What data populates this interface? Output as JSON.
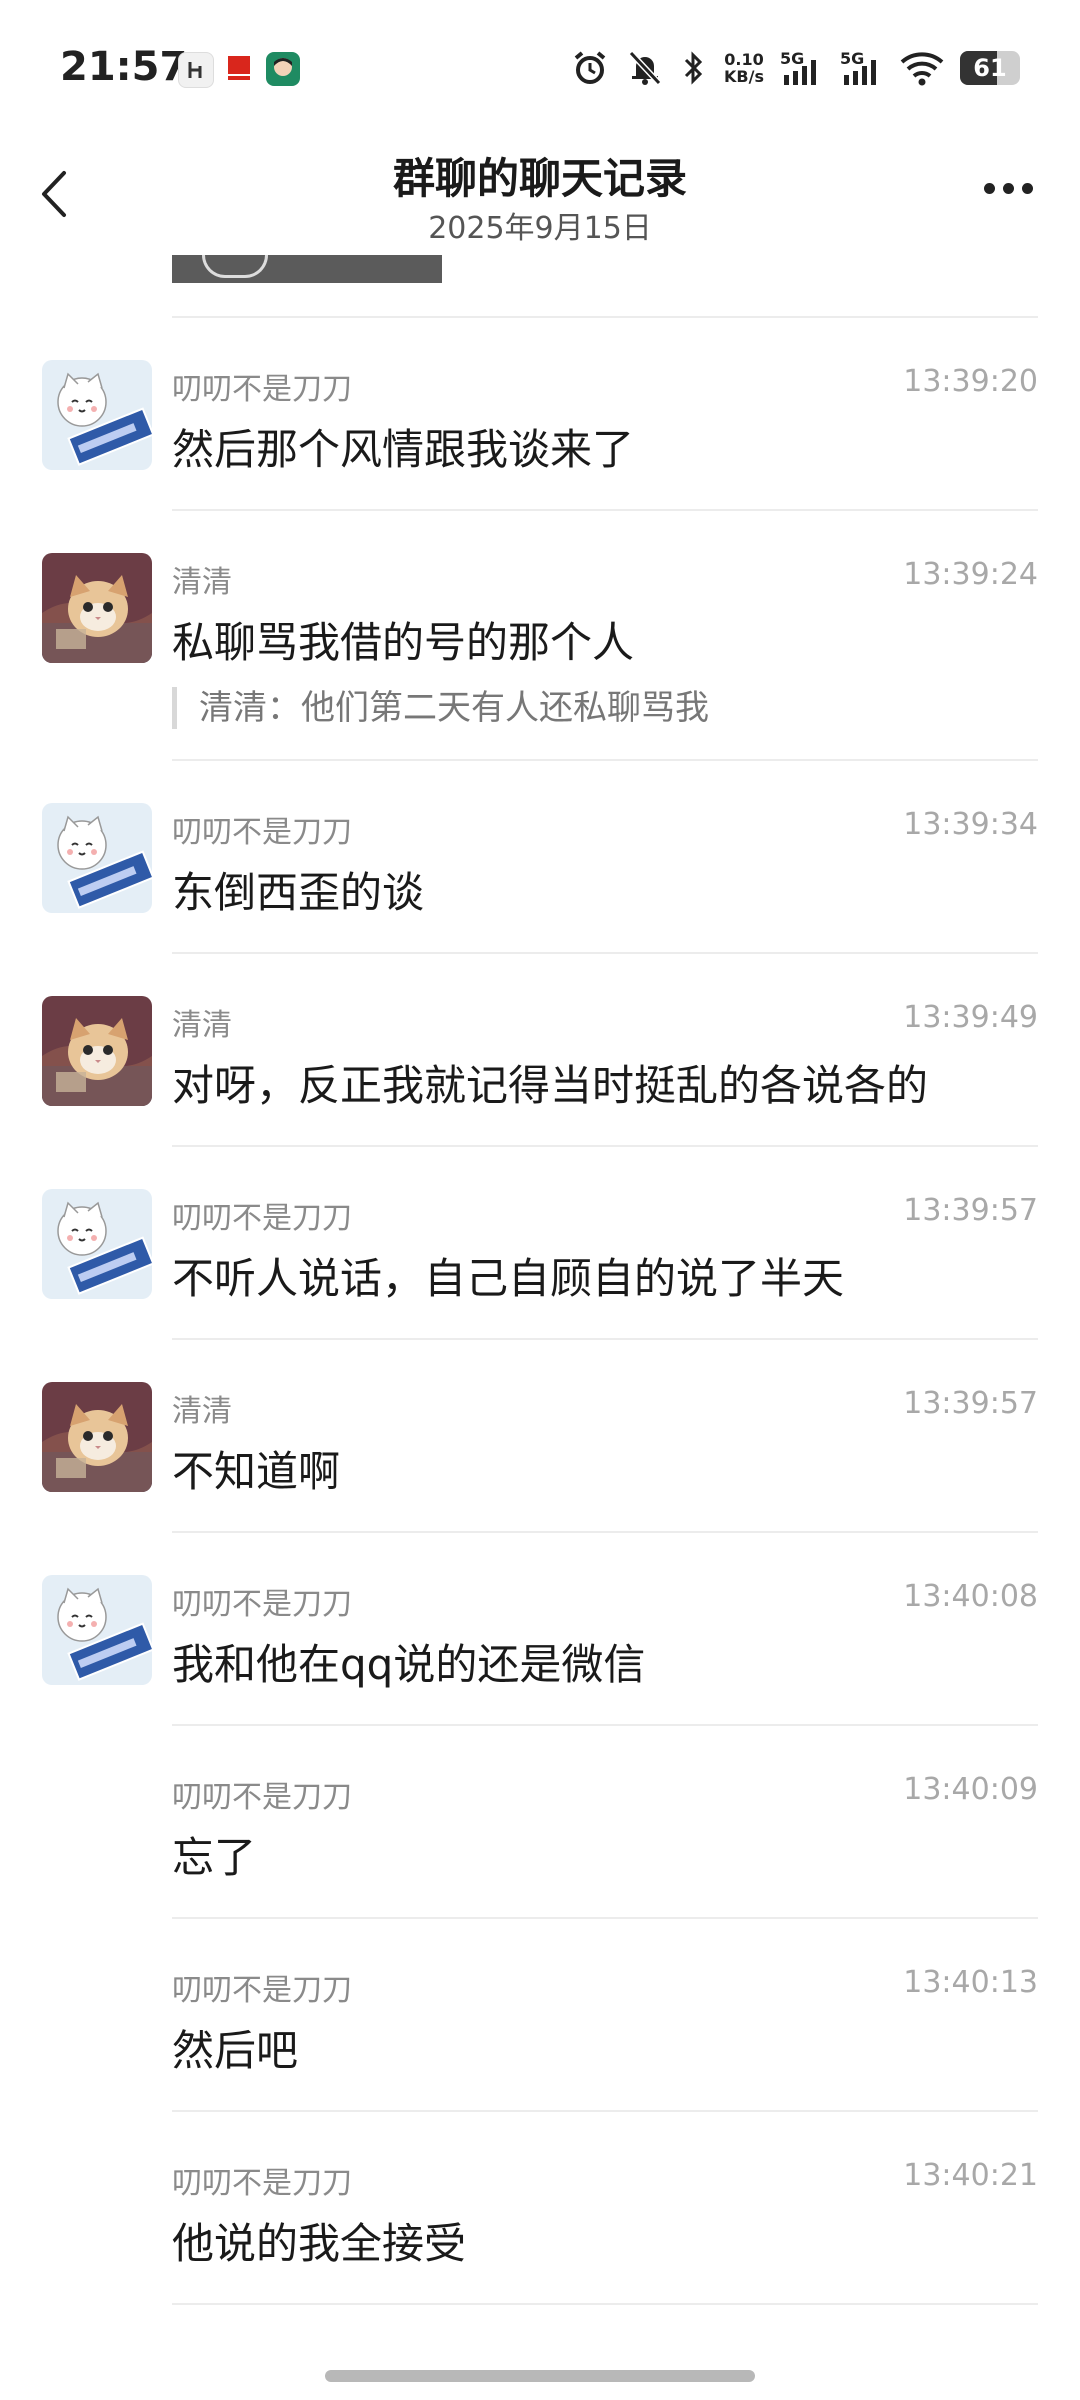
{
  "status_bar": {
    "time": "21:57",
    "net_speed_value": "0.10",
    "net_speed_unit": "KB/s",
    "signal_1": "5G",
    "signal_2": "5G",
    "battery": "61",
    "battery_level": 0.61
  },
  "header": {
    "title": "群聊的聊天记录",
    "date": "2025年9月15日"
  },
  "messages": [
    {
      "sender": "叨叨不是刀刀",
      "time": "13:39:20",
      "text": "然后那个风情跟我谈来了",
      "avatar": "cat-sign-avatar"
    },
    {
      "sender": "清清",
      "time": "13:39:24",
      "text": "私聊骂我借的号的那个人",
      "quote": "清清：他们第二天有人还私聊骂我",
      "avatar": "kitten-photo-avatar"
    },
    {
      "sender": "叨叨不是刀刀",
      "time": "13:39:34",
      "text": "东倒西歪的谈",
      "avatar": "cat-sign-avatar"
    },
    {
      "sender": "清清",
      "time": "13:39:49",
      "text": "对呀，反正我就记得当时挺乱的各说各的",
      "avatar": "kitten-photo-avatar"
    },
    {
      "sender": "叨叨不是刀刀",
      "time": "13:39:57",
      "text": "不听人说话，自己自顾自的说了半天",
      "avatar": "cat-sign-avatar"
    },
    {
      "sender": "清清",
      "time": "13:39:57",
      "text": "不知道啊",
      "avatar": "kitten-photo-avatar"
    },
    {
      "sender": "叨叨不是刀刀",
      "time": "13:40:08",
      "text": "我和他在qq说的还是微信",
      "avatar": "cat-sign-avatar"
    },
    {
      "sender": "叨叨不是刀刀",
      "time": "13:40:09",
      "text": "忘了"
    },
    {
      "sender": "叨叨不是刀刀",
      "time": "13:40:13",
      "text": "然后吧"
    },
    {
      "sender": "叨叨不是刀刀",
      "time": "13:40:21",
      "text": "他说的我全接受"
    }
  ]
}
